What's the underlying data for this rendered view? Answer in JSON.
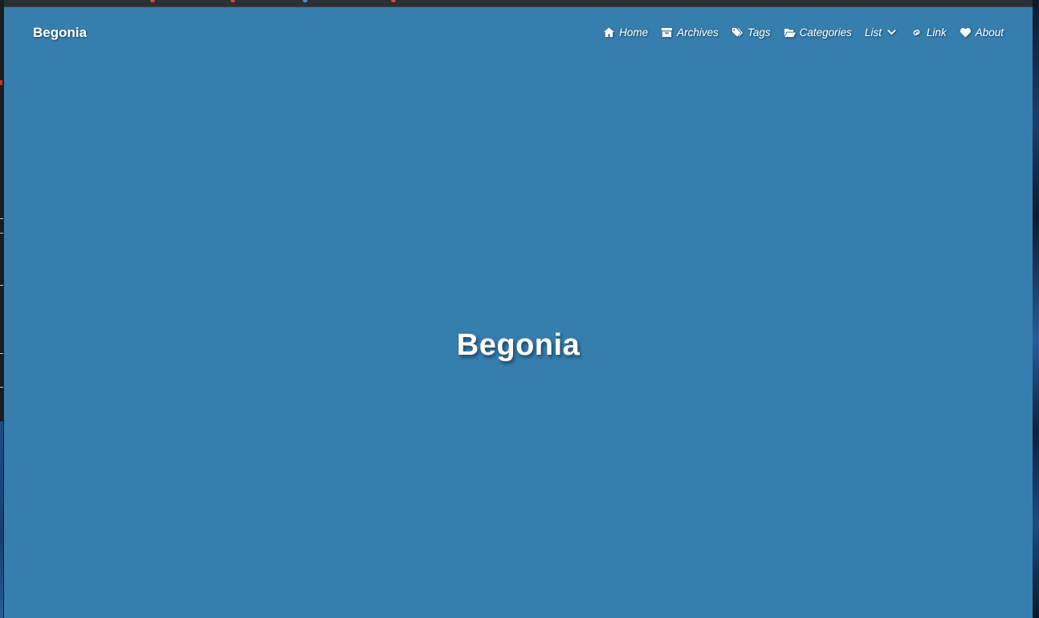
{
  "site": {
    "brand": "Begonia",
    "hero_title": "Begonia"
  },
  "nav": {
    "items": [
      {
        "label": "Home",
        "icon": "home-icon"
      },
      {
        "label": "Archives",
        "icon": "archive-icon"
      },
      {
        "label": "Tags",
        "icon": "tags-icon"
      },
      {
        "label": "Categories",
        "icon": "folder-open-icon"
      },
      {
        "label": "List",
        "icon": "chevron-down-icon"
      },
      {
        "label": "Link",
        "icon": "link-icon"
      },
      {
        "label": "About",
        "icon": "heart-icon"
      }
    ]
  },
  "colors": {
    "page_background": "#367eae",
    "text": "#ffffff"
  }
}
